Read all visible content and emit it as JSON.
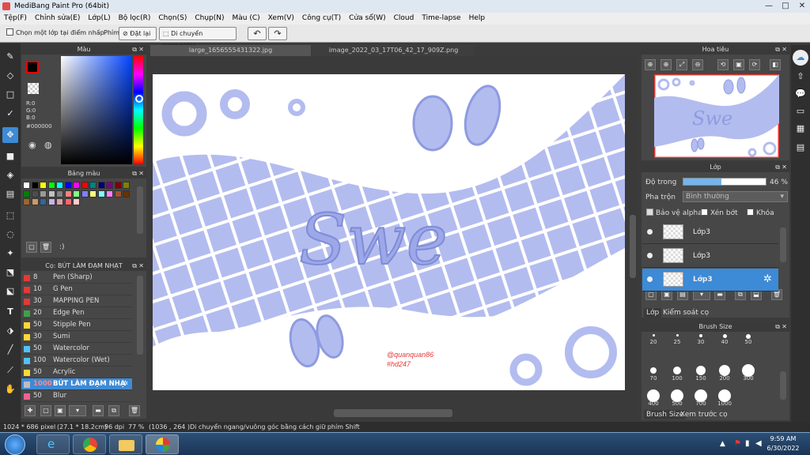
{
  "window": {
    "title": "MediBang Paint Pro (64bit)"
  },
  "menu": [
    "Tệp(F)",
    "Chỉnh sửa(E)",
    "Lớp(L)",
    "Bộ lọc(R)",
    "Chọn(S)",
    "Chụp(N)",
    "Màu (C)",
    "Xem(V)",
    "Công cụ(T)",
    "Cửa sổ(W)",
    "Cloud",
    "Time-lapse",
    "Help"
  ],
  "toolbar": {
    "select_layer_label": "Chọn một lớp tại điểm nhấp",
    "shortcut_label": "Phím",
    "reset_label": "Đặt lại",
    "move_label": "Di chuyển ngang/dọc"
  },
  "color_panel": {
    "title": "Màu",
    "r": "R:0",
    "g": "G:0",
    "b": "B:0",
    "hex": "#000000"
  },
  "palette_panel": {
    "title": "Bảng màu",
    "palette_note": ":)",
    "swatches": [
      "#ffffff",
      "#000000",
      "#ffff00",
      "#00ff00",
      "#00ffff",
      "#0000ff",
      "#ff00ff",
      "#ff0000",
      "#008080",
      "#000080",
      "#800080",
      "#800000",
      "#808000",
      "#008000",
      "#4d4d4d",
      "#999999",
      "#c0c0c0",
      "#808080",
      "#ff8080",
      "#80ff80",
      "#8080ff",
      "#ffff80",
      "#80ffff",
      "#ff80ff",
      "#a0522d",
      "#663300",
      "#996633",
      "#cc9966",
      "#336699",
      "#c8b4e6",
      "#e0a0a0",
      "#ff6666",
      "#ffcccc"
    ]
  },
  "brush_panel": {
    "title": "Cọ: BÚT LÀM ĐẠM NHẠT",
    "brushes": [
      {
        "size": "8",
        "name": "Pen (Sharp)",
        "color": "#e53935"
      },
      {
        "size": "10",
        "name": "G Pen",
        "color": "#e53935"
      },
      {
        "size": "30",
        "name": "MAPPING PEN",
        "color": "#e53935"
      },
      {
        "size": "20",
        "name": "Edge Pen",
        "color": "#43a047"
      },
      {
        "size": "50",
        "name": "Stipple Pen",
        "color": "#fdd835"
      },
      {
        "size": "30",
        "name": "Sumi",
        "color": "#fdd835"
      },
      {
        "size": "50",
        "name": "Watercolor",
        "color": "#4fc3f7"
      },
      {
        "size": "100",
        "name": "Watercolor (Wet)",
        "color": "#4fc3f7"
      },
      {
        "size": "50",
        "name": "Acrylic",
        "color": "#fdd835"
      },
      {
        "size": "1000",
        "name": "BÚT LÀM ĐẠM NHẠ",
        "color": "#bdbdbd",
        "selected": true
      },
      {
        "size": "50",
        "name": "Blur",
        "color": "#f06292"
      }
    ]
  },
  "tabs": [
    "large_1656555431322.jpg",
    "image_2022_03_17T06_42_17_909Z.png"
  ],
  "artwork": {
    "title": "Swe",
    "credit1": "@quanquan86",
    "credit2": "#hd247"
  },
  "navigator": {
    "title": "Hoa tiêu"
  },
  "layer_panel": {
    "title": "Lớp",
    "opacity_label": "Độ trong",
    "opacity_value": "46 %",
    "opacity": 0.46,
    "blend_label": "Pha trộn",
    "blend_value": "Bình thường",
    "protect_alpha": "Bảo vệ alpha",
    "clip": "Xén bớt",
    "lock": "Khóa",
    "layers": [
      {
        "name": "Lớp3"
      },
      {
        "name": "Lớp3"
      },
      {
        "name": "Lớp3",
        "selected": true
      }
    ],
    "tab_layer": "Lớp",
    "tab_control": "Kiểm soát cọ"
  },
  "brush_size_panel": {
    "title": "Brush Size",
    "sizes": [
      "20",
      "25",
      "30",
      "40",
      "50",
      "70",
      "100",
      "150",
      "200",
      "300",
      "400",
      "500",
      "700",
      "1000"
    ],
    "tab_size": "Brush Size",
    "tab_preview": "Xem trước cọ"
  },
  "status": {
    "dims": "1024 * 686 pixel",
    "cm": "(27.1 * 18.2cm)",
    "dpi": "96 dpi",
    "zoom": "77 %",
    "coords": "(1036 , 264 )",
    "hint": "Di chuyển ngang/vuông góc bằng cách giữ phím Shift"
  },
  "clock": {
    "time": "9:59 AM",
    "date": "6/30/2022"
  },
  "colors": {
    "accent": "#3d8ad6",
    "art": "#b3bcef",
    "art_dark": "#8f9be0"
  }
}
